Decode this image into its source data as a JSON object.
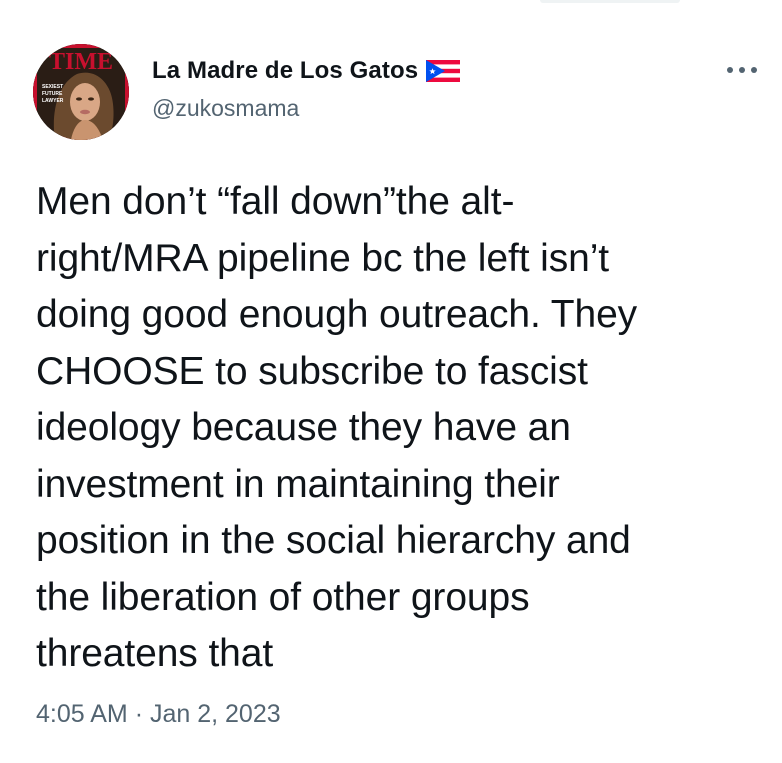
{
  "tweet": {
    "author": {
      "display_name": "La Madre de Los Gatos",
      "flag_icon": "puerto-rico-flag-icon",
      "handle": "@zukosmama",
      "avatar": {
        "magazine_masthead": "TIME",
        "cover_text": "SEXIEST FUTURE LAWYER"
      }
    },
    "more_icon": "more-options-icon",
    "text": "Men don’t “fall down”the alt-\nright/MRA pipeline bc the left isn’t\ndoing good enough outreach. They\nCHOOSE to subscribe to fascist\nideology because they have an\ninvestment in maintaining their\nposition in the social hierarchy and\nthe liberation of other groups\nthreatens that",
    "time": "4:05 AM",
    "separator": "·",
    "date": "Jan 2, 2023"
  },
  "colors": {
    "text_primary": "#0f1419",
    "text_secondary": "#536471",
    "time_cover_red": "#c8102e",
    "flag_red": "#ed0a3f",
    "flag_blue": "#0050f0"
  }
}
